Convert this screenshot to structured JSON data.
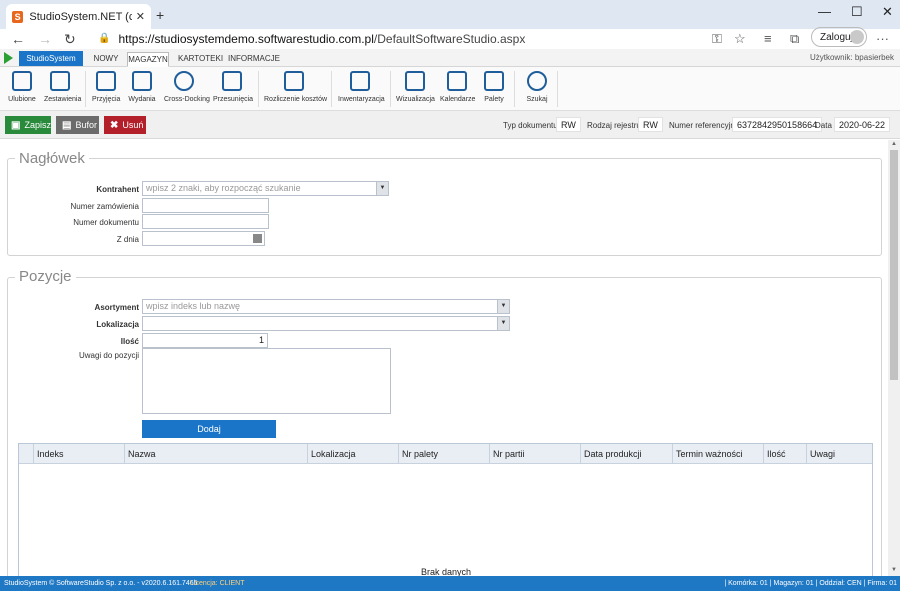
{
  "browser": {
    "tab_title": "StudioSystem.NET (c) SoftwareStudio",
    "favicon_letter": "S",
    "url_host": "https://studiosystemdemo.softwarestudio.com.pl",
    "url_path": "/DefaultSoftwareStudio.aspx",
    "login_label": "Zaloguj",
    "new_tab": "+",
    "minimize": "—",
    "maximize": "☐",
    "close": "✕",
    "tab_close": "✕",
    "back": "←",
    "forward": "→",
    "reload": "↻",
    "lock": "🔒",
    "more": "···"
  },
  "appbar": {
    "brand": "StudioSystem",
    "tabs": [
      "NOWY",
      "MAGAZYN",
      "KARTOTEKI",
      "INFORMACJE"
    ],
    "active_tab": "MAGAZYN",
    "user": "Użytkownik: bpasierbek"
  },
  "ribbon": {
    "items": [
      "Ulubione",
      "Zestawienia",
      "Przyjęcia",
      "Wydania",
      "Cross-Docking",
      "Przesunięcia",
      "Rozliczenie kosztów",
      "Inwentaryzacja",
      "Wizualizacja",
      "Kalendarze",
      "Palety",
      "Szukaj"
    ]
  },
  "toolbar": {
    "save": "Zapisz",
    "buffer": "Bufor",
    "delete": "Usuń",
    "doc_type_label": "Typ dokumentu",
    "doc_type_value": "RW",
    "registry_label": "Rodzaj rejestru",
    "registry_value": "RW",
    "ref_label": "Numer referencyjny",
    "ref_value": "6372842950158664",
    "date_label": "Data",
    "date_value": "2020-06-22"
  },
  "header_section": {
    "legend": "Nagłówek",
    "contractor_label": "Kontrahent",
    "contractor_placeholder": "wpisz 2 znaki, aby rozpocząć szukanie",
    "order_no_label": "Numer zamówienia",
    "doc_no_label": "Numer dokumentu",
    "date_label": "Z dnia"
  },
  "items_section": {
    "legend": "Pozycje",
    "assortment_label": "Asortyment",
    "assortment_placeholder": "wpisz indeks lub nazwę",
    "location_label": "Lokalizacja",
    "qty_label": "Ilość",
    "qty_value": "1",
    "notes_label": "Uwagi do pozycji",
    "add_button": "Dodaj"
  },
  "grid": {
    "columns": [
      "",
      "Indeks",
      "Nazwa",
      "Lokalizacja",
      "Nr palety",
      "Nr partii",
      "Data produkcji",
      "Termin ważności",
      "Ilość",
      "Uwagi"
    ],
    "empty_text": "Brak danych"
  },
  "status": {
    "copyright": "StudioSystem © SoftwareStudio Sp. z o.o. - v2020.6.161.7465",
    "license": "Licencja: CLIENT",
    "right": "| Komórka: 01 | Magazyn: 01 | Oddział: CEN | Firma: 01"
  },
  "colors": {
    "accent": "#1a75c9",
    "save": "#2a8a3c",
    "buffer": "#6b6b6b",
    "delete": "#b3202a",
    "statusbar": "#1f78c4"
  }
}
